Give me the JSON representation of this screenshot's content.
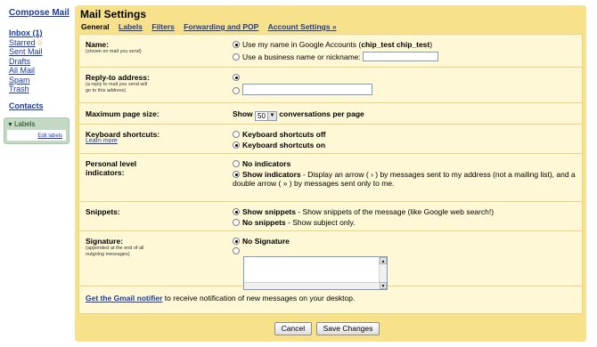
{
  "nav": {
    "compose": "Compose Mail",
    "items": [
      {
        "label": "Inbox (1)"
      },
      {
        "label": "Starred"
      },
      {
        "label": "Sent Mail"
      },
      {
        "label": "Drafts"
      },
      {
        "label": "All Mail"
      },
      {
        "label": "Spam"
      },
      {
        "label": "Trash"
      }
    ],
    "contacts": "Contacts",
    "labels_title": "Labels",
    "edit_labels": "Edit labels"
  },
  "settings": {
    "title": "Mail Settings",
    "tabs": [
      "General",
      "Labels",
      "Filters",
      "Forwarding and POP",
      "Account Settings »"
    ],
    "active_tab": "General"
  },
  "name": {
    "label": "Name:",
    "sub": "(shown on mail you send)",
    "opt1_text": "Use my name in Google Accounts (",
    "opt1_name": "chip_test chip_test",
    "opt1_close": ")",
    "opt2_text": "Use a business name or nickname:",
    "nickname_value": ""
  },
  "reply_to": {
    "label": "Reply-to address:",
    "sub": "(a reply to mail you send will go to this address)",
    "value": ""
  },
  "page_size": {
    "label": "Maximum page size:",
    "show": "Show",
    "selected": "50",
    "suffix": "conversations per page"
  },
  "shortcuts": {
    "label": "Keyboard shortcuts:",
    "learn_more": "Learn more",
    "off": "Keyboard shortcuts off",
    "on": "Keyboard shortcuts on"
  },
  "indicators": {
    "label": "Personal level indicators:",
    "none": "No indicators",
    "show": "Show indicators",
    "show_desc": " - Display an arrow ( › ) by messages sent to my address (not a mailing list), and a double arrow ( » ) by messages sent only to me."
  },
  "snippets": {
    "label": "Snippets:",
    "show": "Show snippets",
    "show_desc": " - Show snippets of the message (like Google web search!)",
    "none": "No snippets",
    "none_desc": " - Show subject only."
  },
  "signature": {
    "label": "Signature:",
    "sub": "(appended at the end of all outgoing messages)",
    "none": "No Signature",
    "value": ""
  },
  "notifier": {
    "link": "Get the Gmail notifier",
    "text": " to receive notification of new messages on your desktop."
  },
  "buttons": {
    "cancel": "Cancel",
    "save": "Save Changes"
  },
  "colors": {
    "panel": "#f7e28b",
    "content": "#fff8d6",
    "link": "#1d3b9e",
    "labels_box": "#c3d9c3"
  }
}
